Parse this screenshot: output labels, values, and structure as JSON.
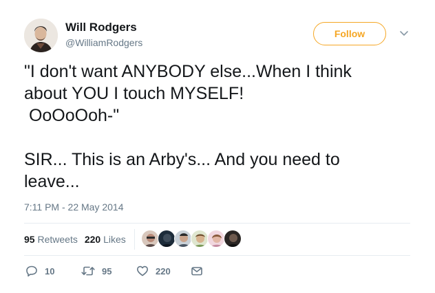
{
  "author": {
    "name": "Will Rodgers",
    "handle": "@WilliamRodgers"
  },
  "follow_button": {
    "label": "Follow"
  },
  "tweet": {
    "line1": "\"I don't want ANYBODY else...When I think\nabout YOU I touch MYSELF!\n OoOoOoh-\"",
    "line2": "SIR... This is an Arby's... And you need to\nleave...",
    "timestamp": "7:11 PM - 22 May 2014"
  },
  "stats": {
    "retweets_count": "95",
    "retweets_label": "Retweets",
    "likes_count": "220",
    "likes_label": "Likes"
  },
  "likers": [
    {
      "name": "liker-1",
      "color": "#b98a78"
    },
    {
      "name": "liker-2",
      "color": "#1d2c3a"
    },
    {
      "name": "liker-3",
      "color": "#4a5563"
    },
    {
      "name": "liker-4",
      "color": "#7c9a5a"
    },
    {
      "name": "liker-5",
      "color": "#c48aa0"
    },
    {
      "name": "liker-6",
      "color": "#2a2624"
    }
  ],
  "actions": {
    "replies": "10",
    "retweets": "95",
    "likes": "220"
  },
  "colors": {
    "accent": "#f5a623",
    "text": "#14171a",
    "muted": "#657786",
    "divider": "#e6ecf0"
  }
}
